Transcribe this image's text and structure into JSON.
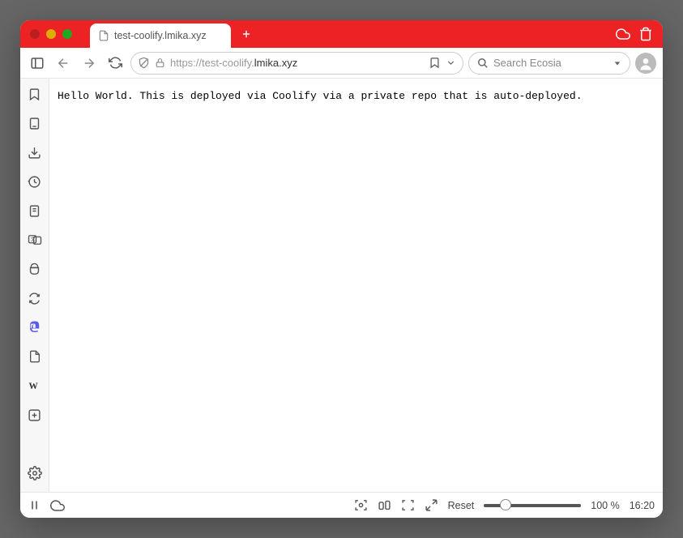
{
  "tab": {
    "title": "test-coolify.lmika.xyz"
  },
  "url": {
    "prefix": "https://test-coolify.",
    "bold": "lmika.xyz"
  },
  "search": {
    "placeholder": "Search Ecosia"
  },
  "page": {
    "body": "Hello World. This is deployed via Coolify via a private repo that is auto-deployed."
  },
  "status": {
    "reset": "Reset",
    "zoom": "100 %",
    "time": "16:20"
  }
}
